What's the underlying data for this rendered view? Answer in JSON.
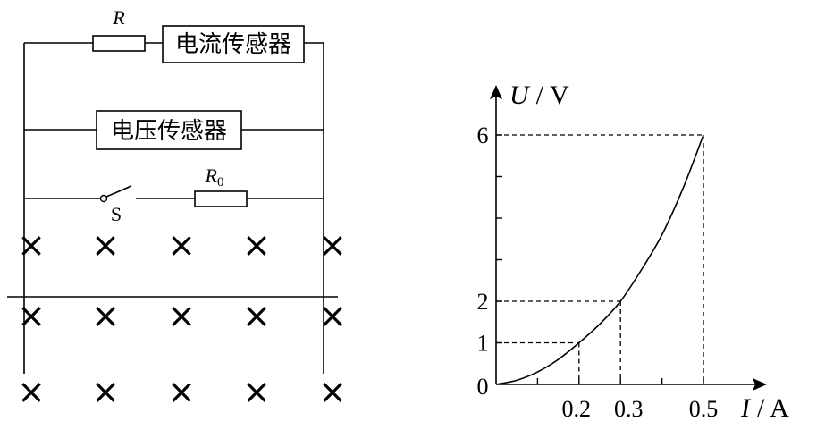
{
  "circuit": {
    "resistor_label": "R",
    "current_sensor_label": "电流传感器",
    "voltage_sensor_label": "电压传感器",
    "r0_label_main": "R",
    "r0_label_sub": "0",
    "switch_label": "S",
    "field_symbol": "×"
  },
  "chart_data": {
    "type": "line",
    "xlabel_var": "I",
    "xlabel_unit": "/ A",
    "ylabel_var": "U",
    "ylabel_unit": "/ V",
    "origin_label": "0",
    "x_tick_labels": [
      "0.2",
      "0.3",
      "0.5"
    ],
    "y_tick_labels": [
      "1",
      "2",
      "6"
    ],
    "xlim": [
      0,
      0.65
    ],
    "ylim": [
      0,
      7
    ],
    "x_minor_ticks": [
      0.1,
      0.2,
      0.3,
      0.4,
      0.5
    ],
    "y_minor_ticks": [
      1,
      2,
      3,
      4,
      5,
      6
    ],
    "marked_points": [
      {
        "x": 0.2,
        "y": 1
      },
      {
        "x": 0.3,
        "y": 2
      },
      {
        "x": 0.5,
        "y": 6
      }
    ],
    "curve_points": [
      {
        "x": 0,
        "y": 0
      },
      {
        "x": 0.05,
        "y": 0.1
      },
      {
        "x": 0.1,
        "y": 0.3
      },
      {
        "x": 0.15,
        "y": 0.6
      },
      {
        "x": 0.2,
        "y": 1
      },
      {
        "x": 0.25,
        "y": 1.45
      },
      {
        "x": 0.3,
        "y": 2
      },
      {
        "x": 0.35,
        "y": 2.75
      },
      {
        "x": 0.4,
        "y": 3.6
      },
      {
        "x": 0.45,
        "y": 4.7
      },
      {
        "x": 0.5,
        "y": 6
      }
    ]
  }
}
